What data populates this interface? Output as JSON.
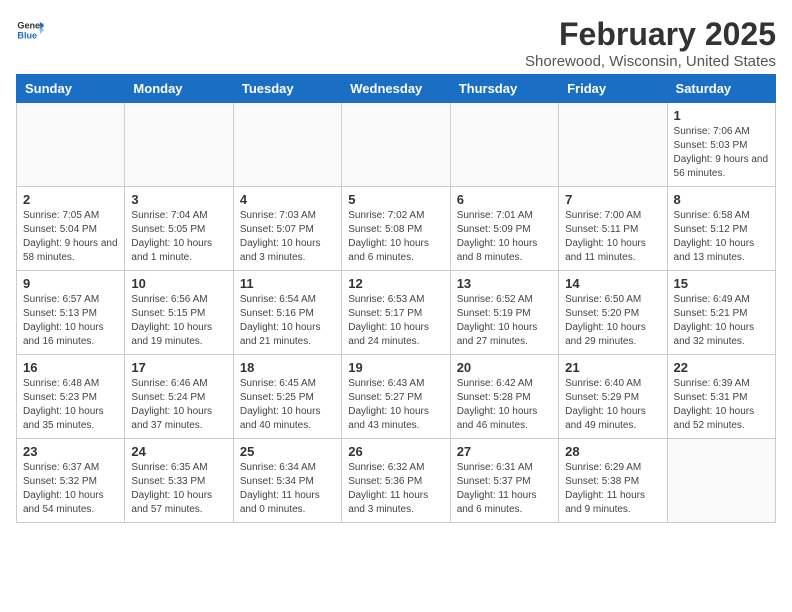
{
  "header": {
    "logo_general": "General",
    "logo_blue": "Blue",
    "title": "February 2025",
    "subtitle": "Shorewood, Wisconsin, United States"
  },
  "days_of_week": [
    "Sunday",
    "Monday",
    "Tuesday",
    "Wednesday",
    "Thursday",
    "Friday",
    "Saturday"
  ],
  "weeks": [
    [
      {
        "day": "",
        "info": ""
      },
      {
        "day": "",
        "info": ""
      },
      {
        "day": "",
        "info": ""
      },
      {
        "day": "",
        "info": ""
      },
      {
        "day": "",
        "info": ""
      },
      {
        "day": "",
        "info": ""
      },
      {
        "day": "1",
        "info": "Sunrise: 7:06 AM\nSunset: 5:03 PM\nDaylight: 9 hours and 56 minutes."
      }
    ],
    [
      {
        "day": "2",
        "info": "Sunrise: 7:05 AM\nSunset: 5:04 PM\nDaylight: 9 hours and 58 minutes."
      },
      {
        "day": "3",
        "info": "Sunrise: 7:04 AM\nSunset: 5:05 PM\nDaylight: 10 hours and 1 minute."
      },
      {
        "day": "4",
        "info": "Sunrise: 7:03 AM\nSunset: 5:07 PM\nDaylight: 10 hours and 3 minutes."
      },
      {
        "day": "5",
        "info": "Sunrise: 7:02 AM\nSunset: 5:08 PM\nDaylight: 10 hours and 6 minutes."
      },
      {
        "day": "6",
        "info": "Sunrise: 7:01 AM\nSunset: 5:09 PM\nDaylight: 10 hours and 8 minutes."
      },
      {
        "day": "7",
        "info": "Sunrise: 7:00 AM\nSunset: 5:11 PM\nDaylight: 10 hours and 11 minutes."
      },
      {
        "day": "8",
        "info": "Sunrise: 6:58 AM\nSunset: 5:12 PM\nDaylight: 10 hours and 13 minutes."
      }
    ],
    [
      {
        "day": "9",
        "info": "Sunrise: 6:57 AM\nSunset: 5:13 PM\nDaylight: 10 hours and 16 minutes."
      },
      {
        "day": "10",
        "info": "Sunrise: 6:56 AM\nSunset: 5:15 PM\nDaylight: 10 hours and 19 minutes."
      },
      {
        "day": "11",
        "info": "Sunrise: 6:54 AM\nSunset: 5:16 PM\nDaylight: 10 hours and 21 minutes."
      },
      {
        "day": "12",
        "info": "Sunrise: 6:53 AM\nSunset: 5:17 PM\nDaylight: 10 hours and 24 minutes."
      },
      {
        "day": "13",
        "info": "Sunrise: 6:52 AM\nSunset: 5:19 PM\nDaylight: 10 hours and 27 minutes."
      },
      {
        "day": "14",
        "info": "Sunrise: 6:50 AM\nSunset: 5:20 PM\nDaylight: 10 hours and 29 minutes."
      },
      {
        "day": "15",
        "info": "Sunrise: 6:49 AM\nSunset: 5:21 PM\nDaylight: 10 hours and 32 minutes."
      }
    ],
    [
      {
        "day": "16",
        "info": "Sunrise: 6:48 AM\nSunset: 5:23 PM\nDaylight: 10 hours and 35 minutes."
      },
      {
        "day": "17",
        "info": "Sunrise: 6:46 AM\nSunset: 5:24 PM\nDaylight: 10 hours and 37 minutes."
      },
      {
        "day": "18",
        "info": "Sunrise: 6:45 AM\nSunset: 5:25 PM\nDaylight: 10 hours and 40 minutes."
      },
      {
        "day": "19",
        "info": "Sunrise: 6:43 AM\nSunset: 5:27 PM\nDaylight: 10 hours and 43 minutes."
      },
      {
        "day": "20",
        "info": "Sunrise: 6:42 AM\nSunset: 5:28 PM\nDaylight: 10 hours and 46 minutes."
      },
      {
        "day": "21",
        "info": "Sunrise: 6:40 AM\nSunset: 5:29 PM\nDaylight: 10 hours and 49 minutes."
      },
      {
        "day": "22",
        "info": "Sunrise: 6:39 AM\nSunset: 5:31 PM\nDaylight: 10 hours and 52 minutes."
      }
    ],
    [
      {
        "day": "23",
        "info": "Sunrise: 6:37 AM\nSunset: 5:32 PM\nDaylight: 10 hours and 54 minutes."
      },
      {
        "day": "24",
        "info": "Sunrise: 6:35 AM\nSunset: 5:33 PM\nDaylight: 10 hours and 57 minutes."
      },
      {
        "day": "25",
        "info": "Sunrise: 6:34 AM\nSunset: 5:34 PM\nDaylight: 11 hours and 0 minutes."
      },
      {
        "day": "26",
        "info": "Sunrise: 6:32 AM\nSunset: 5:36 PM\nDaylight: 11 hours and 3 minutes."
      },
      {
        "day": "27",
        "info": "Sunrise: 6:31 AM\nSunset: 5:37 PM\nDaylight: 11 hours and 6 minutes."
      },
      {
        "day": "28",
        "info": "Sunrise: 6:29 AM\nSunset: 5:38 PM\nDaylight: 11 hours and 9 minutes."
      },
      {
        "day": "",
        "info": ""
      }
    ]
  ]
}
